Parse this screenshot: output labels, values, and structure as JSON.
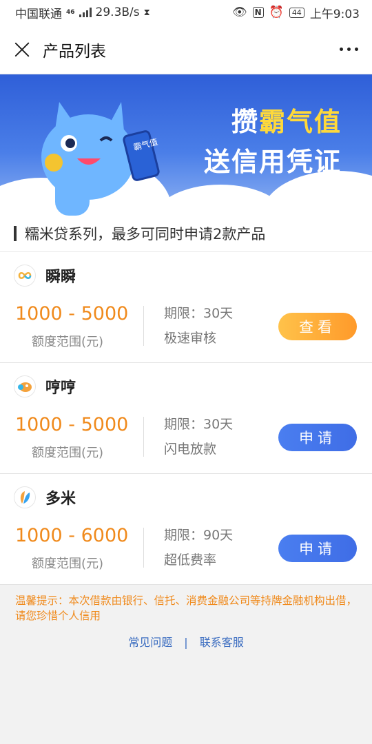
{
  "status_bar": {
    "carrier": "中国联通",
    "network": "46",
    "speed": "29.3B/s",
    "battery": "44",
    "time": "上午9:03"
  },
  "title_bar": {
    "title": "产品列表"
  },
  "banner": {
    "line1_white": "攒",
    "line1_yellow": "霸气值",
    "line2": "送信用凭证",
    "phone_text": "霸气值"
  },
  "section": {
    "title": "糯米贷系列，最多可同时申请2款产品"
  },
  "products": [
    {
      "name": "瞬瞬",
      "amount": "1000 - 5000",
      "amount_label": "额度范围(元)",
      "term": "期限：30天",
      "feature": "极速审核",
      "button": "查看",
      "button_color": "#ffac38"
    },
    {
      "name": "哼哼",
      "amount": "1000 - 5000",
      "amount_label": "额度范围(元)",
      "term": "期限：30天",
      "feature": "闪电放款",
      "button": "申请",
      "button_color": "#4476ec"
    },
    {
      "name": "多米",
      "amount": "1000 - 6000",
      "amount_label": "额度范围(元)",
      "term": "期限：90天",
      "feature": "超低费率",
      "button": "申请",
      "button_color": "#4476ec"
    }
  ],
  "tip": "温馨提示：本次借款由银行、信托、消费金融公司等持牌金融机构出借，请您珍惜个人信用",
  "links": {
    "faq": "常见问题",
    "separator": "|",
    "contact": "联系客服"
  }
}
